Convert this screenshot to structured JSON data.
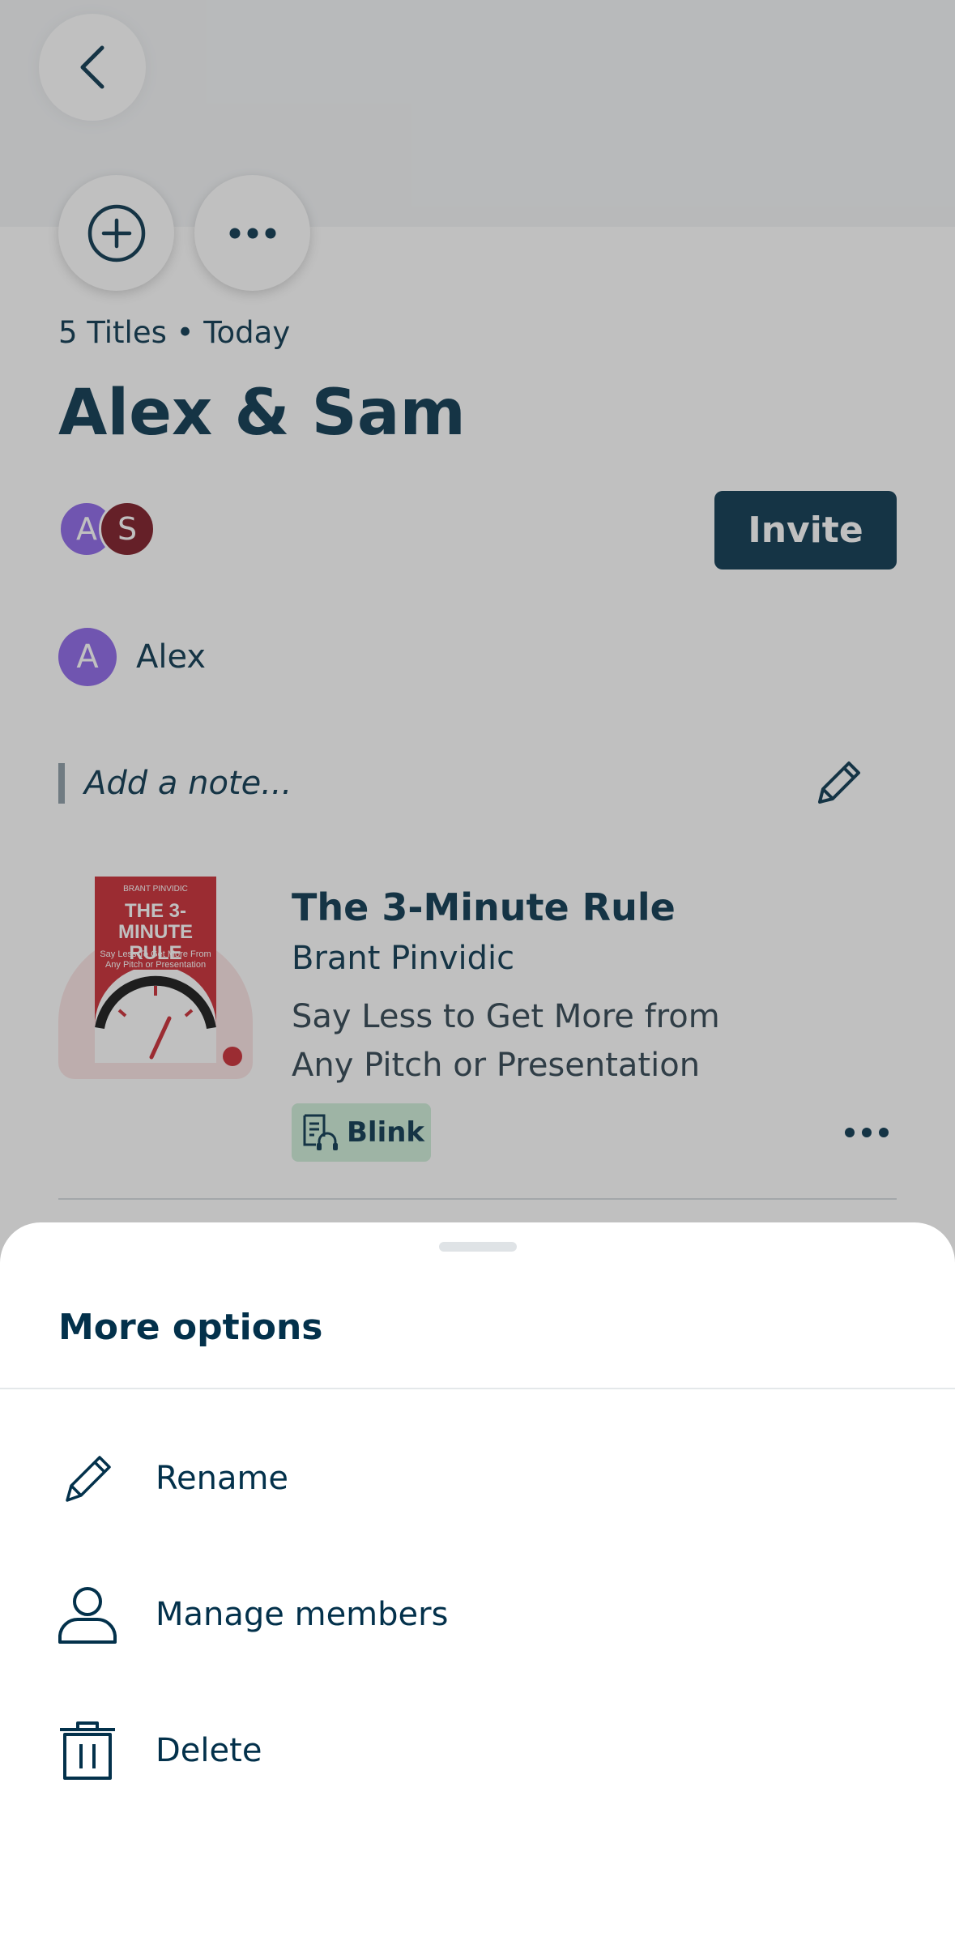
{
  "header": {
    "back_icon": "chevron-left-icon",
    "add_icon": "plus-circle-icon",
    "more_icon": "ellipsis-icon"
  },
  "playlist": {
    "meta": "5 Titles • Today",
    "title": "Alex & Sam",
    "members": [
      {
        "initial": "A",
        "color": "#8a62e8"
      },
      {
        "initial": "S",
        "color": "#7a1420"
      }
    ],
    "invite_label": "Invite",
    "owner": {
      "initial": "A",
      "name": "Alex"
    },
    "note_placeholder": "Add a note..."
  },
  "book": {
    "title": "The 3-Minute Rule",
    "author": "Brant Pinvidic",
    "description": "Say Less to Get More from Any Pitch or Presentation",
    "badge_label": "Blink",
    "cover": {
      "author": "BRANT PINVIDIC",
      "title": "THE 3-MINUTE RULE",
      "subtitle": "Say Less To Get More From Any Pitch or Presentation"
    }
  },
  "sheet": {
    "title": "More options",
    "options": [
      {
        "label": "Rename",
        "icon": "pencil-icon"
      },
      {
        "label": "Manage members",
        "icon": "person-icon"
      },
      {
        "label": "Delete",
        "icon": "trash-icon"
      }
    ]
  },
  "colors": {
    "primary": "#03314b",
    "accent_purple": "#8a62e8",
    "badge_bg": "#cdeed8"
  }
}
